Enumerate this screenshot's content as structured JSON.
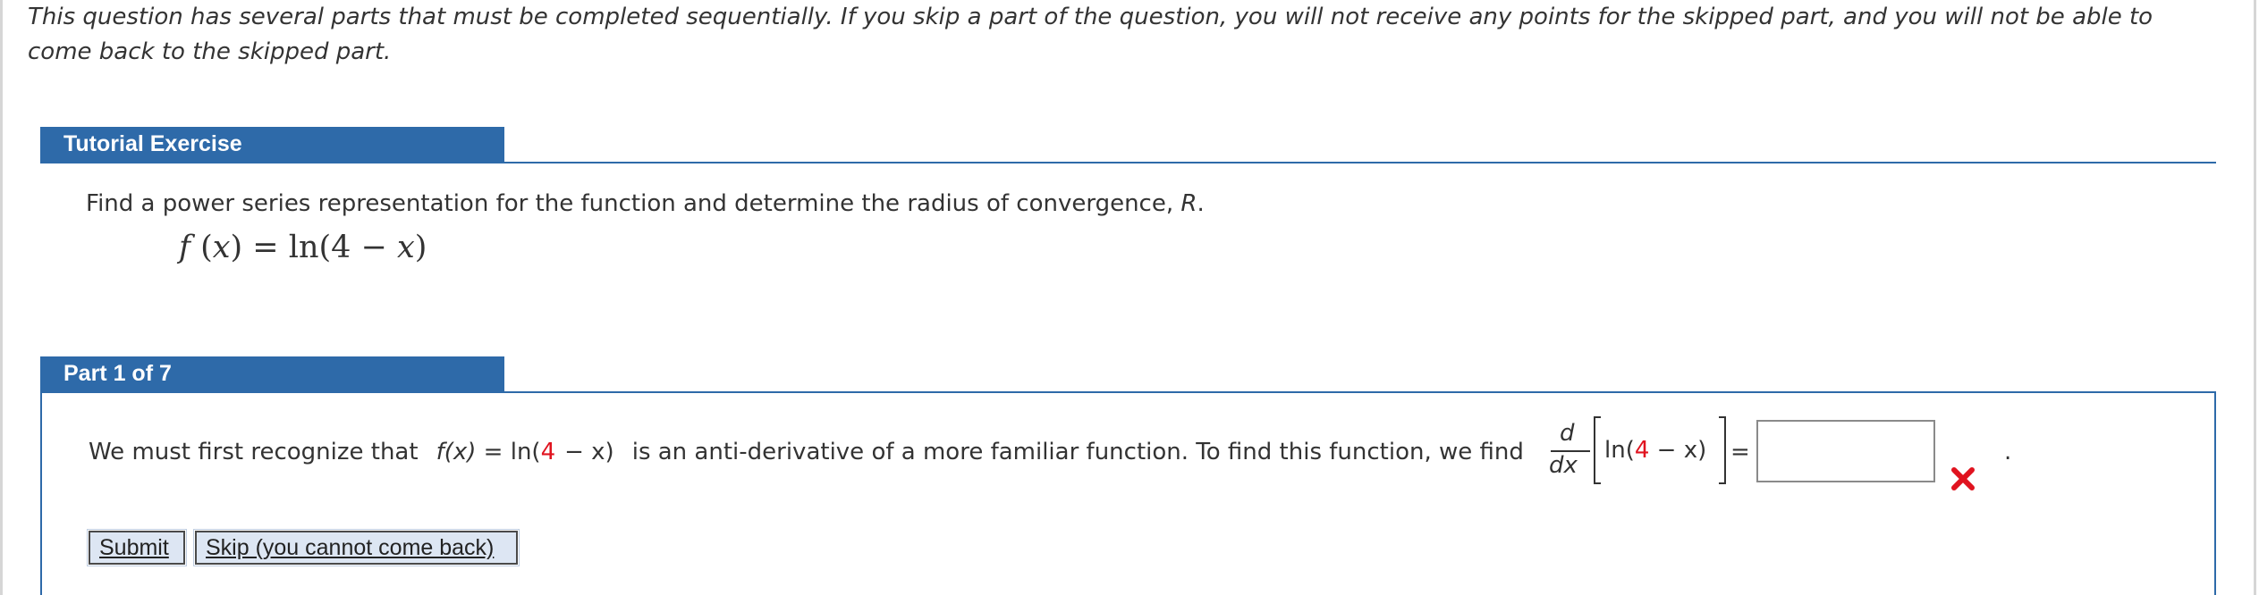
{
  "intro": {
    "text": "This question has several parts that must be completed sequentially. If you skip a part of the question, you will not receive any points for the skipped part, and you will not be able to come back to the skipped part."
  },
  "tutorial": {
    "header": "Tutorial Exercise",
    "question_prefix": "Find a power series representation for the function and determine the radius of convergence, ",
    "question_var": "R",
    "question_suffix": ".",
    "formula": {
      "f": "f",
      "x1": "x",
      "eq": "=",
      "ln": "ln",
      "four": "4",
      "minus": "−",
      "x2": "x"
    }
  },
  "part": {
    "header": "Part 1 of 7",
    "text_before": "We must first recognize that",
    "fx": "f(x)",
    "equals": "=",
    "ln_open": "ln(",
    "four": "4",
    "minus_x": "− x)",
    "text_middle": "is an anti-derivative of a more familiar function. To find this function, we find",
    "deriv_num": "d",
    "deriv_den": "dx",
    "bracket_ln_open": "ln(",
    "bracket_four": "4",
    "bracket_minus_x": "− x)",
    "eq_sign": "=",
    "answer_value": "",
    "period": ".",
    "status_icon": "red-x-icon",
    "status_color": "#e0131f"
  },
  "buttons": {
    "submit": "Submit",
    "skip": "Skip (you cannot come back)"
  },
  "colors": {
    "header_blue": "#2e6aa9",
    "accent_red": "#e0131f",
    "button_bg": "#dde6f3"
  }
}
